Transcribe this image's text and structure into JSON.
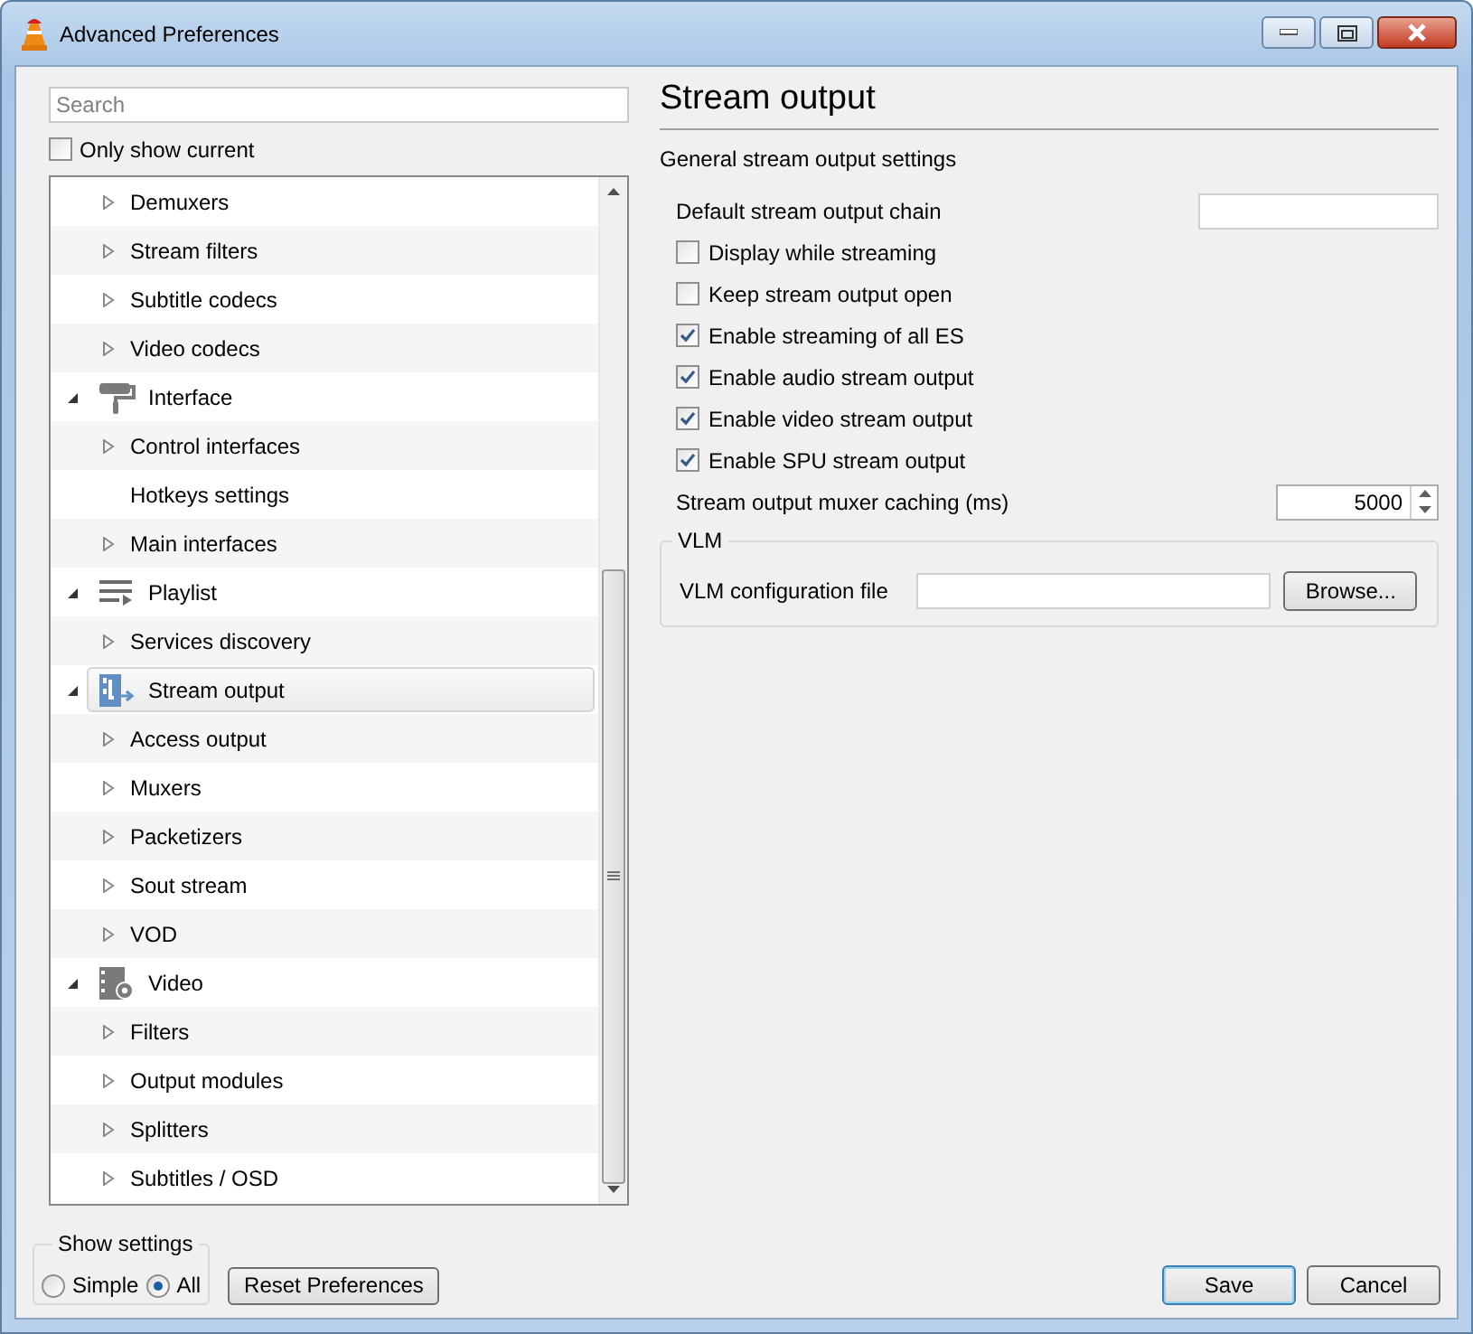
{
  "window": {
    "title": "Advanced Preferences"
  },
  "sidebar": {
    "search": {
      "placeholder": "Search"
    },
    "only_show_current": {
      "label": "Only show current",
      "checked": false
    },
    "tree": [
      {
        "kind": "continued",
        "children": [
          {
            "label": "Demuxers",
            "expandable": true,
            "selected": false
          },
          {
            "label": "Stream filters",
            "expandable": true,
            "selected": false
          },
          {
            "label": "Subtitle codecs",
            "expandable": true,
            "selected": false
          },
          {
            "label": "Video codecs",
            "expandable": true,
            "selected": false
          }
        ]
      },
      {
        "kind": "category",
        "label": "Interface",
        "expanded": true,
        "selected": false,
        "children": [
          {
            "label": "Control interfaces",
            "expandable": true,
            "selected": false
          },
          {
            "label": "Hotkeys settings",
            "expandable": false,
            "selected": false
          },
          {
            "label": "Main interfaces",
            "expandable": true,
            "selected": false
          }
        ]
      },
      {
        "kind": "category",
        "label": "Playlist",
        "expanded": true,
        "selected": false,
        "children": [
          {
            "label": "Services discovery",
            "expandable": true,
            "selected": false
          }
        ]
      },
      {
        "kind": "category",
        "label": "Stream output",
        "expanded": true,
        "selected": true,
        "children": [
          {
            "label": "Access output",
            "expandable": true,
            "selected": false
          },
          {
            "label": "Muxers",
            "expandable": true,
            "selected": false
          },
          {
            "label": "Packetizers",
            "expandable": true,
            "selected": false
          },
          {
            "label": "Sout stream",
            "expandable": true,
            "selected": false
          },
          {
            "label": "VOD",
            "expandable": true,
            "selected": false
          }
        ]
      },
      {
        "kind": "category",
        "label": "Video",
        "expanded": true,
        "selected": false,
        "children": [
          {
            "label": "Filters",
            "expandable": true,
            "selected": false
          },
          {
            "label": "Output modules",
            "expandable": true,
            "selected": false
          },
          {
            "label": "Splitters",
            "expandable": true,
            "selected": false
          },
          {
            "label": "Subtitles / OSD",
            "expandable": true,
            "selected": false
          }
        ]
      }
    ]
  },
  "panel": {
    "title": "Stream output",
    "subtitle": "General stream output settings",
    "settings": [
      {
        "kind": "text",
        "label": "Default stream output chain"
      },
      {
        "kind": "checkbox",
        "label": "Display while streaming",
        "checked": false
      },
      {
        "kind": "checkbox",
        "label": "Keep stream output open",
        "checked": false
      },
      {
        "kind": "checkbox",
        "label": "Enable streaming of all ES",
        "checked": true
      },
      {
        "kind": "checkbox",
        "label": "Enable audio stream output",
        "checked": true
      },
      {
        "kind": "checkbox",
        "label": "Enable video stream output",
        "checked": true
      },
      {
        "kind": "checkbox",
        "label": "Enable SPU stream output",
        "checked": true
      },
      {
        "kind": "spin",
        "label": "Stream output muxer caching (ms)",
        "value": "5000"
      }
    ],
    "group": {
      "title": "VLM",
      "label": "VLM configuration file",
      "button": "Browse..."
    }
  },
  "footer": {
    "show_settings": {
      "title": "Show settings",
      "options": [
        {
          "label": "Simple",
          "selected": false
        },
        {
          "label": "All",
          "selected": true
        }
      ]
    },
    "reset": "Reset Preferences",
    "buttons": [
      {
        "label": "Save",
        "default": true
      },
      {
        "label": "Cancel",
        "default": false
      }
    ]
  }
}
